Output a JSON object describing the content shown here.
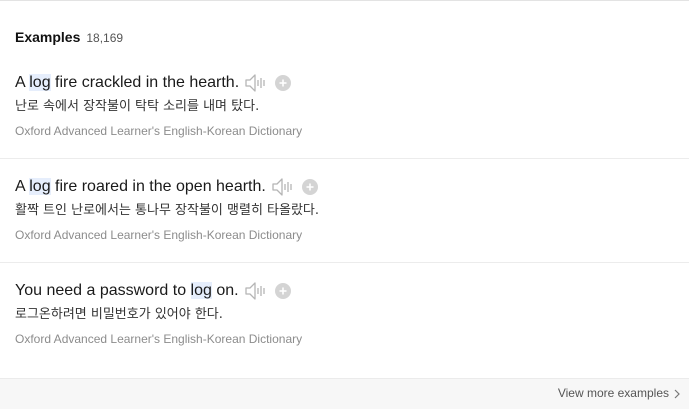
{
  "header": {
    "title": "Examples",
    "count": "18,169"
  },
  "examples": [
    {
      "before": "A ",
      "highlight": "log",
      "after": " fire crackled in the hearth.",
      "translation": "난로 속에서 장작불이 탁탁 소리를 내며 탔다.",
      "source": "Oxford Advanced Learner's English-Korean Dictionary"
    },
    {
      "before": "A ",
      "highlight": "log",
      "after": " fire roared in the open hearth.",
      "translation": "활짝 트인 난로에서는 통나무 장작불이 맹렬히 타올랐다.",
      "source": "Oxford Advanced Learner's English-Korean Dictionary"
    },
    {
      "before": "You need a password to ",
      "highlight": "log",
      "after": " on.",
      "translation": "로그온하려면 비밀번호가 있어야 한다.",
      "source": "Oxford Advanced Learner's English-Korean Dictionary"
    }
  ],
  "footer": {
    "view_more_label": "View more examples"
  },
  "icons": {
    "speaker": "speaker-icon",
    "add": "plus-circle-icon",
    "chevron": "chevron-right-icon"
  },
  "colors": {
    "highlight_bg": "#e6eefc",
    "icon_gray": "#c4c4c4",
    "source_text": "#8c8c8c"
  }
}
